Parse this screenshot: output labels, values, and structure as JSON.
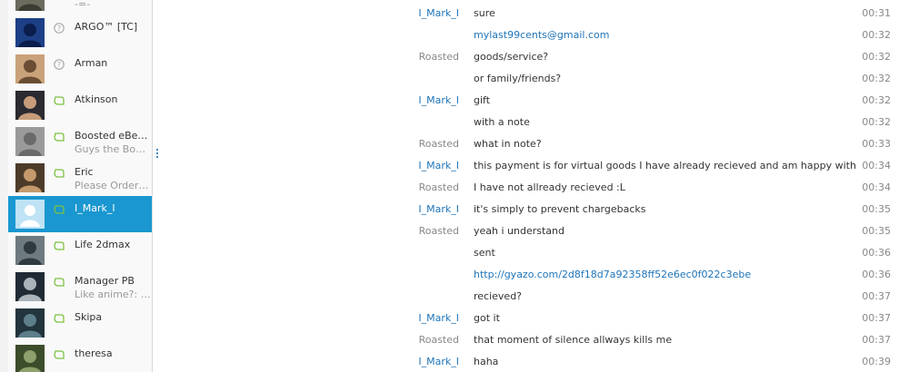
{
  "sidebar": {
    "contacts": [
      {
        "name": "",
        "sub": "-=-",
        "status": "unknown",
        "selected": false
      },
      {
        "name": "ARGO™ [TC]",
        "sub": "",
        "status": "unknown",
        "selected": false
      },
      {
        "name": "Arman",
        "sub": "",
        "status": "unknown",
        "selected": false
      },
      {
        "name": "Atkinson",
        "sub": "",
        "status": "offline-leaf",
        "selected": false
      },
      {
        "name": "Boosted eBear...",
        "sub": "Guys the Boos...",
        "status": "offline-leaf",
        "selected": false
      },
      {
        "name": "Eric",
        "sub": "Please Order f...",
        "status": "offline-leaf",
        "selected": false
      },
      {
        "name": "I_Mark_I",
        "sub": "",
        "status": "offline-leaf",
        "selected": true
      },
      {
        "name": "Life 2dmax",
        "sub": "",
        "status": "offline-leaf",
        "selected": false
      },
      {
        "name": "Manager PB",
        "sub": "Like anime?: h...",
        "status": "offline-leaf",
        "selected": false
      },
      {
        "name": "Skipa",
        "sub": "",
        "status": "offline-leaf",
        "selected": false
      },
      {
        "name": "theresa",
        "sub": "",
        "status": "offline-leaf",
        "selected": false
      }
    ]
  },
  "chat": {
    "messages": [
      {
        "sender": "I_Mark_I",
        "text": "sure",
        "time": "00:31"
      },
      {
        "sender": "",
        "text": "mylast99cents@gmail.com",
        "time": "00:32",
        "link": true
      },
      {
        "sender": "Roasted",
        "text": "goods/service?",
        "time": "00:32"
      },
      {
        "sender": "",
        "text": "or family/friends?",
        "time": "00:32"
      },
      {
        "sender": "I_Mark_I",
        "text": "gift",
        "time": "00:32"
      },
      {
        "sender": "",
        "text": "with a note",
        "time": "00:32"
      },
      {
        "sender": "Roasted",
        "text": "what in note?",
        "time": "00:33"
      },
      {
        "sender": "I_Mark_I",
        "text": "this payment is for virtual goods I have already recieved and am happy with",
        "time": "00:34"
      },
      {
        "sender": "Roasted",
        "text": "I have not allready recieved :L",
        "time": "00:34"
      },
      {
        "sender": "I_Mark_I",
        "text": "it's simply to prevent chargebacks",
        "time": "00:35"
      },
      {
        "sender": "Roasted",
        "text": "yeah i understand",
        "time": "00:35"
      },
      {
        "sender": "",
        "text": "sent",
        "time": "00:36"
      },
      {
        "sender": "",
        "text": "http://gyazo.com/2d8f18d7a92358ff52e6ec0f022c3ebe",
        "time": "00:36",
        "link": true
      },
      {
        "sender": "",
        "text": "recieved?",
        "time": "00:37"
      },
      {
        "sender": "I_Mark_I",
        "text": "got it",
        "time": "00:37"
      },
      {
        "sender": "Roasted",
        "text": "that moment of silence allways kills me",
        "time": "00:37"
      },
      {
        "sender": "I_Mark_I",
        "text": "haha",
        "time": "00:39"
      }
    ]
  },
  "colors": {
    "selected_bg": "#1a97d0",
    "link": "#1e74b8",
    "status_leaf": "#7cc242",
    "status_unknown": "#aaaaaa"
  }
}
